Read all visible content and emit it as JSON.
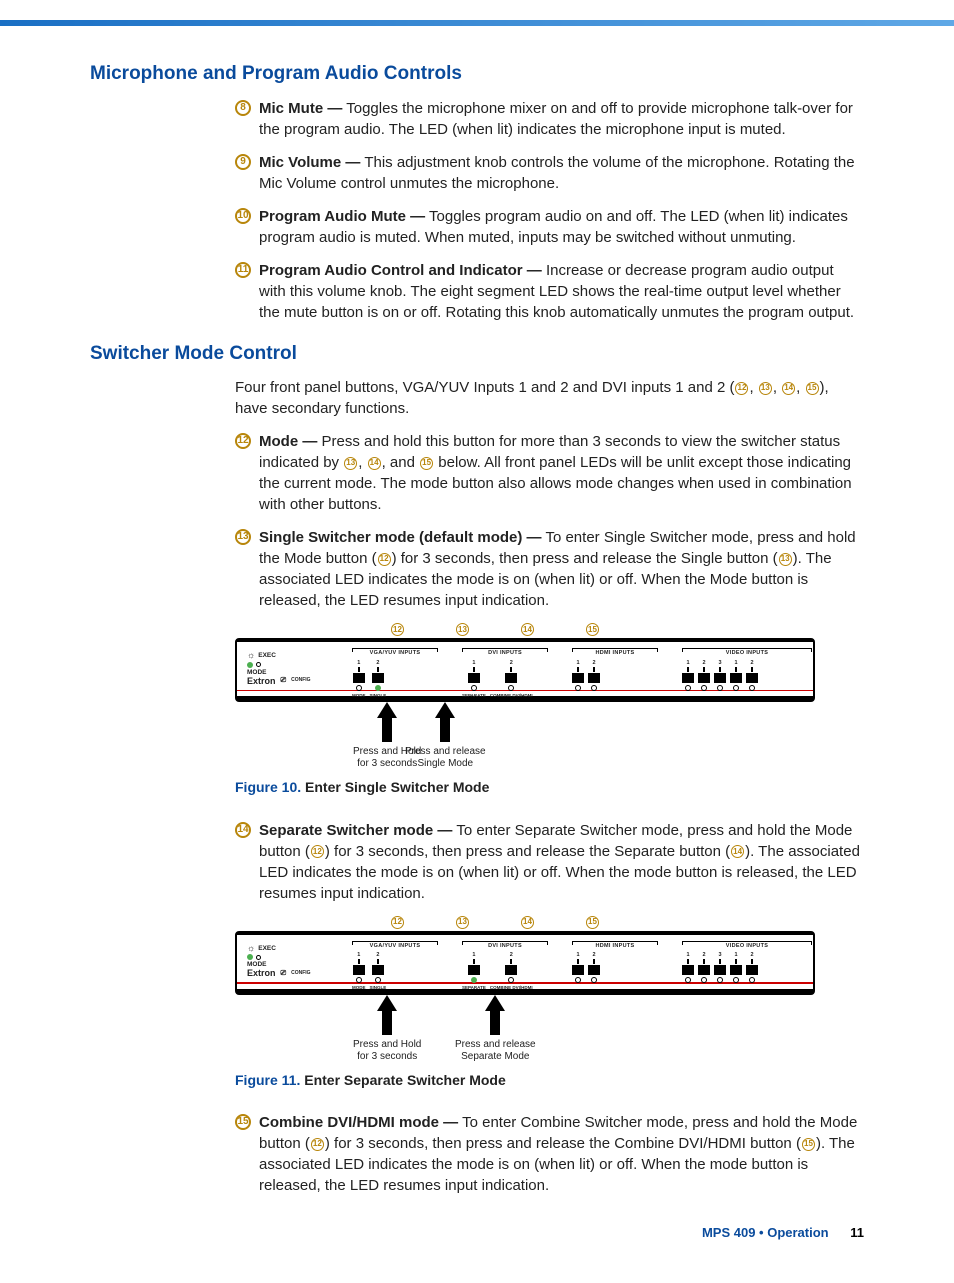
{
  "headings": {
    "h1": "Microphone and Program Audio Controls",
    "h2": "Switcher Mode Control"
  },
  "items": {
    "i8": {
      "n": "8",
      "term": "Mic Mute —",
      "body": "Toggles the microphone mixer on and off to provide microphone talk-over for the program audio. The LED (when lit) indicates the microphone input is muted."
    },
    "i9": {
      "n": "9",
      "term": "Mic Volume —",
      "body": "This adjustment knob controls the volume of the microphone. Rotating the Mic Volume control unmutes the microphone."
    },
    "i10": {
      "n": "10",
      "term": "Program Audio Mute —",
      "body": "Toggles program audio on and off. The LED (when lit) indicates program audio is muted. When muted, inputs may be switched without unmuting."
    },
    "i11": {
      "n": "11",
      "term": "Program Audio Control and Indicator —",
      "body": "Increase or decrease program audio output with this volume knob. The eight segment LED shows the real-time output level whether the mute button is on or off. Rotating this knob automatically unmutes the program output."
    },
    "i12": {
      "n": "12",
      "term": "Mode —",
      "pre": "Press and hold this button for more than 3 seconds to view the switcher status indicated by ",
      "mid": " below. All front panel LEDs will be unlit except those indicating the current mode. The mode button also allows mode changes when used in combination with other buttons."
    },
    "i13": {
      "n": "13",
      "term": "Single Switcher mode (default mode) —",
      "body": "To enter Single Switcher mode, press and hold the Mode button (",
      "mid": ") for 3 seconds, then press and release the Single button (",
      "end": "). The associated LED indicates the mode is on (when lit) or off. When the Mode button is released, the LED resumes input indication."
    },
    "i14": {
      "n": "14",
      "term": "Separate Switcher mode —",
      "body": "To enter Separate Switcher mode, press and hold the Mode button (",
      "mid": ") for 3 seconds, then press and release the Separate button (",
      "end": "). The associated LED indicates the mode is on (when lit) or off. When the mode button is released, the LED resumes input indication."
    },
    "i15": {
      "n": "15",
      "term": "Combine DVI/HDMI mode —",
      "body": "To enter Combine Switcher mode, press and hold the Mode button (",
      "mid": ") for 3 seconds, then press and release the Combine DVI/HDMI button (",
      "end": "). The associated LED indicates the mode is on (when lit) or off. When the mode button is released, the LED resumes input indication."
    }
  },
  "intro": {
    "pre": "Four front panel buttons, VGA/YUV Inputs 1 and 2 and DVI inputs 1 and 2 (",
    "post": "), have secondary functions."
  },
  "refs": {
    "r12": "12",
    "r13": "13",
    "r14": "14",
    "r15": "15"
  },
  "panel": {
    "exec": "EXEC",
    "mode": "MODE",
    "config": "CONFIG",
    "brand": "Extron",
    "groups": {
      "vga": "VGA/YUV INPUTS",
      "dvi": "DVI INPUTS",
      "hdmi": "HDMI INPUTS",
      "video": "VIDEO INPUTS"
    },
    "nums": {
      "n1": "1",
      "n2": "2",
      "n3": "3"
    },
    "subs": {
      "mode": "MODE",
      "single": "SINGLE",
      "separate": "SEPARATE",
      "combine": "COMBINE DVI/HDMI"
    }
  },
  "arrows": {
    "hold1": "Press and Hold",
    "hold2": "for 3 seconds",
    "single1": "Press and release",
    "single2": "Single Mode",
    "sep1": "Press and release",
    "sep2": "Separate Mode"
  },
  "fig10": {
    "n": "Figure 10.",
    "t": "Enter Single Switcher Mode"
  },
  "fig11": {
    "n": "Figure 11.",
    "t": "Enter Separate Switcher Mode"
  },
  "footer": {
    "doc": "MPS 409 • Operation",
    "page": "11"
  }
}
